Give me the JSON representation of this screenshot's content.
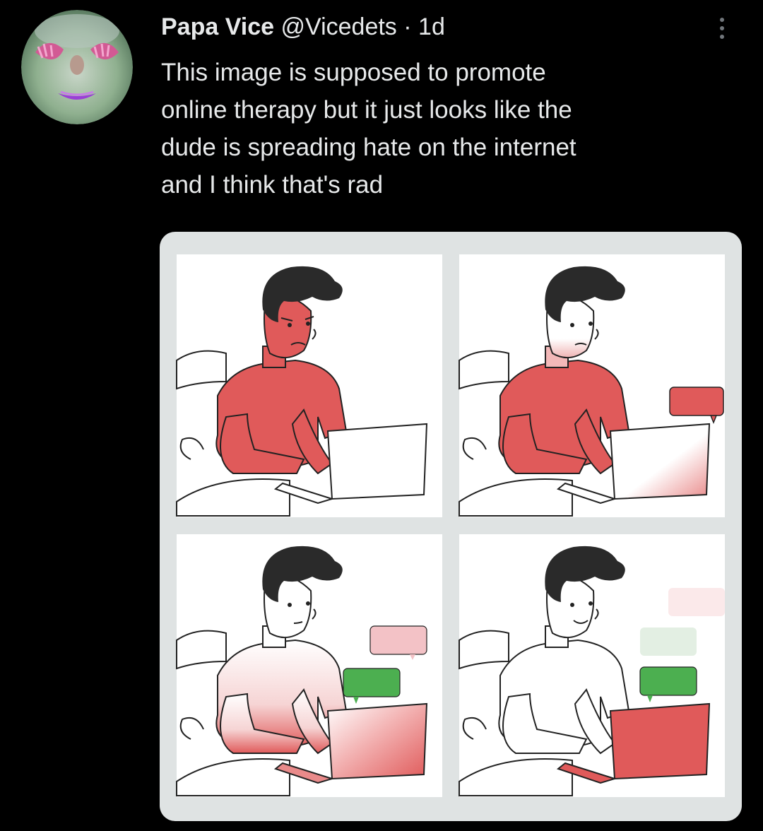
{
  "tweet": {
    "display_name": "Papa Vice",
    "handle": "@Vicedets",
    "separator": "·",
    "time": "1d",
    "text": "This image is supposed to promote\nonline therapy but it just looks like the\ndude is spreading hate on the internet\nand I think that's rad"
  },
  "icons": {
    "avatar": "avatar-image",
    "more": "more-options-icon"
  },
  "colors": {
    "background": "#000000",
    "text": "#e7e9ea",
    "illustration_red": "#e05a5a",
    "illustration_green": "#4caf50",
    "panel_border": "#dfe3e3"
  }
}
